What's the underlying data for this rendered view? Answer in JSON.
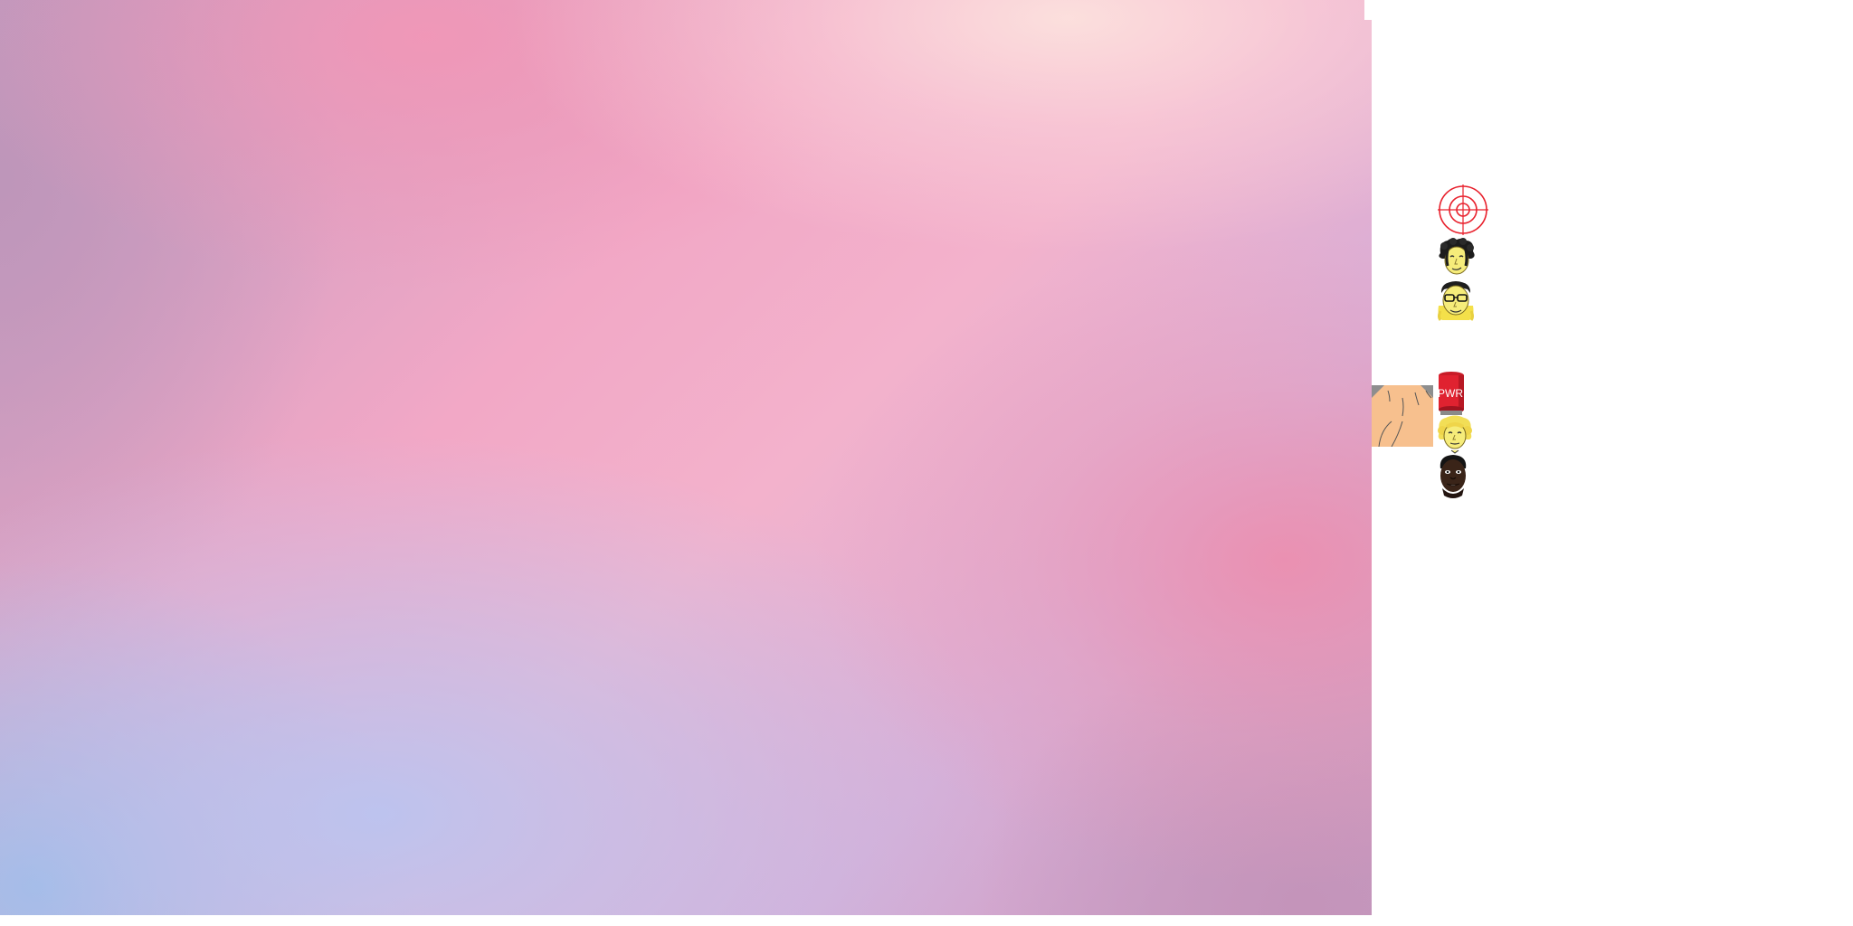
{
  "scene": {
    "background": {
      "type": "gradient",
      "colors": [
        "#c29ac0",
        "#f2a8c6",
        "#fbd6dc",
        "#b8c4f0",
        "#96b8e4",
        "#ee8cac"
      ]
    },
    "canvas_color": "#ffffff"
  },
  "sprites": [
    {
      "name": "target-icon",
      "color": "#e8202c"
    },
    {
      "name": "face-curly-hair-icon",
      "color": "#f6ec7a"
    },
    {
      "name": "face-glasses-icon",
      "color": "#f6ec7a"
    },
    {
      "name": "skin-tile",
      "color": "#f7c08e"
    },
    {
      "name": "power-can-icon",
      "color": "#e02230"
    },
    {
      "name": "face-blonde-icon",
      "color": "#f6ec7a"
    },
    {
      "name": "face-dark-icon",
      "color": "#3a2418"
    }
  ],
  "power_can": {
    "label": "PWR"
  }
}
